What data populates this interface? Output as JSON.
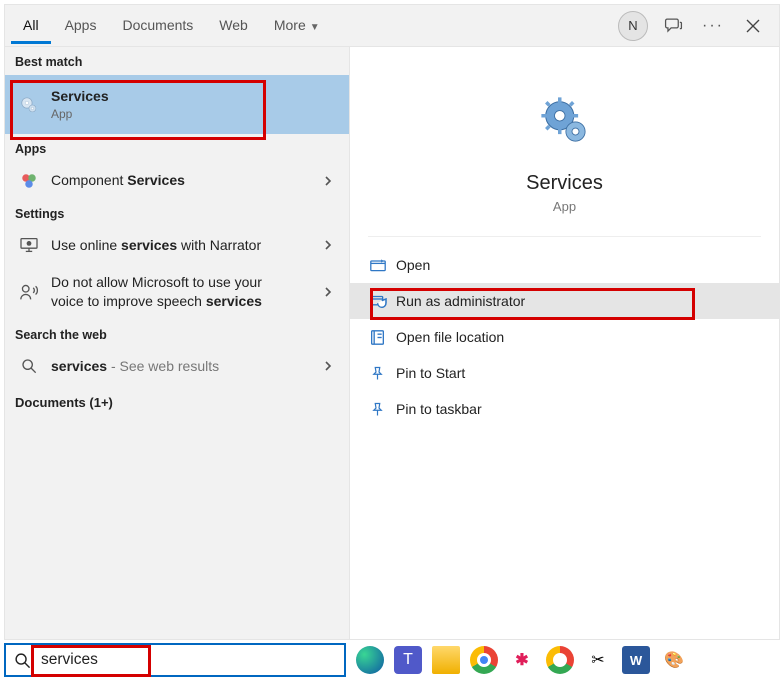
{
  "tabs": [
    "All",
    "Apps",
    "Documents",
    "Web",
    "More"
  ],
  "avatar_initial": "N",
  "sections": {
    "best_match": {
      "label": "Best match",
      "item_title": "Services",
      "item_sub": "App"
    },
    "apps": {
      "label": "Apps",
      "item_pre": "Component ",
      "item_bold": "Services"
    },
    "settings": {
      "label": "Settings",
      "item1_pre": "Use online ",
      "item1_bold": "services",
      "item1_post": " with Narrator",
      "item2_line1": "Do not allow Microsoft to use your",
      "item2_line2_pre": "voice to improve speech ",
      "item2_line2_bold": "services"
    },
    "web": {
      "label": "Search the web",
      "item_bold": "services",
      "item_post": " - See web results"
    },
    "documents_label": "Documents (1+)"
  },
  "preview": {
    "title": "Services",
    "sub": "App"
  },
  "actions": [
    "Open",
    "Run as administrator",
    "Open file location",
    "Pin to Start",
    "Pin to taskbar"
  ],
  "search_value": "services"
}
